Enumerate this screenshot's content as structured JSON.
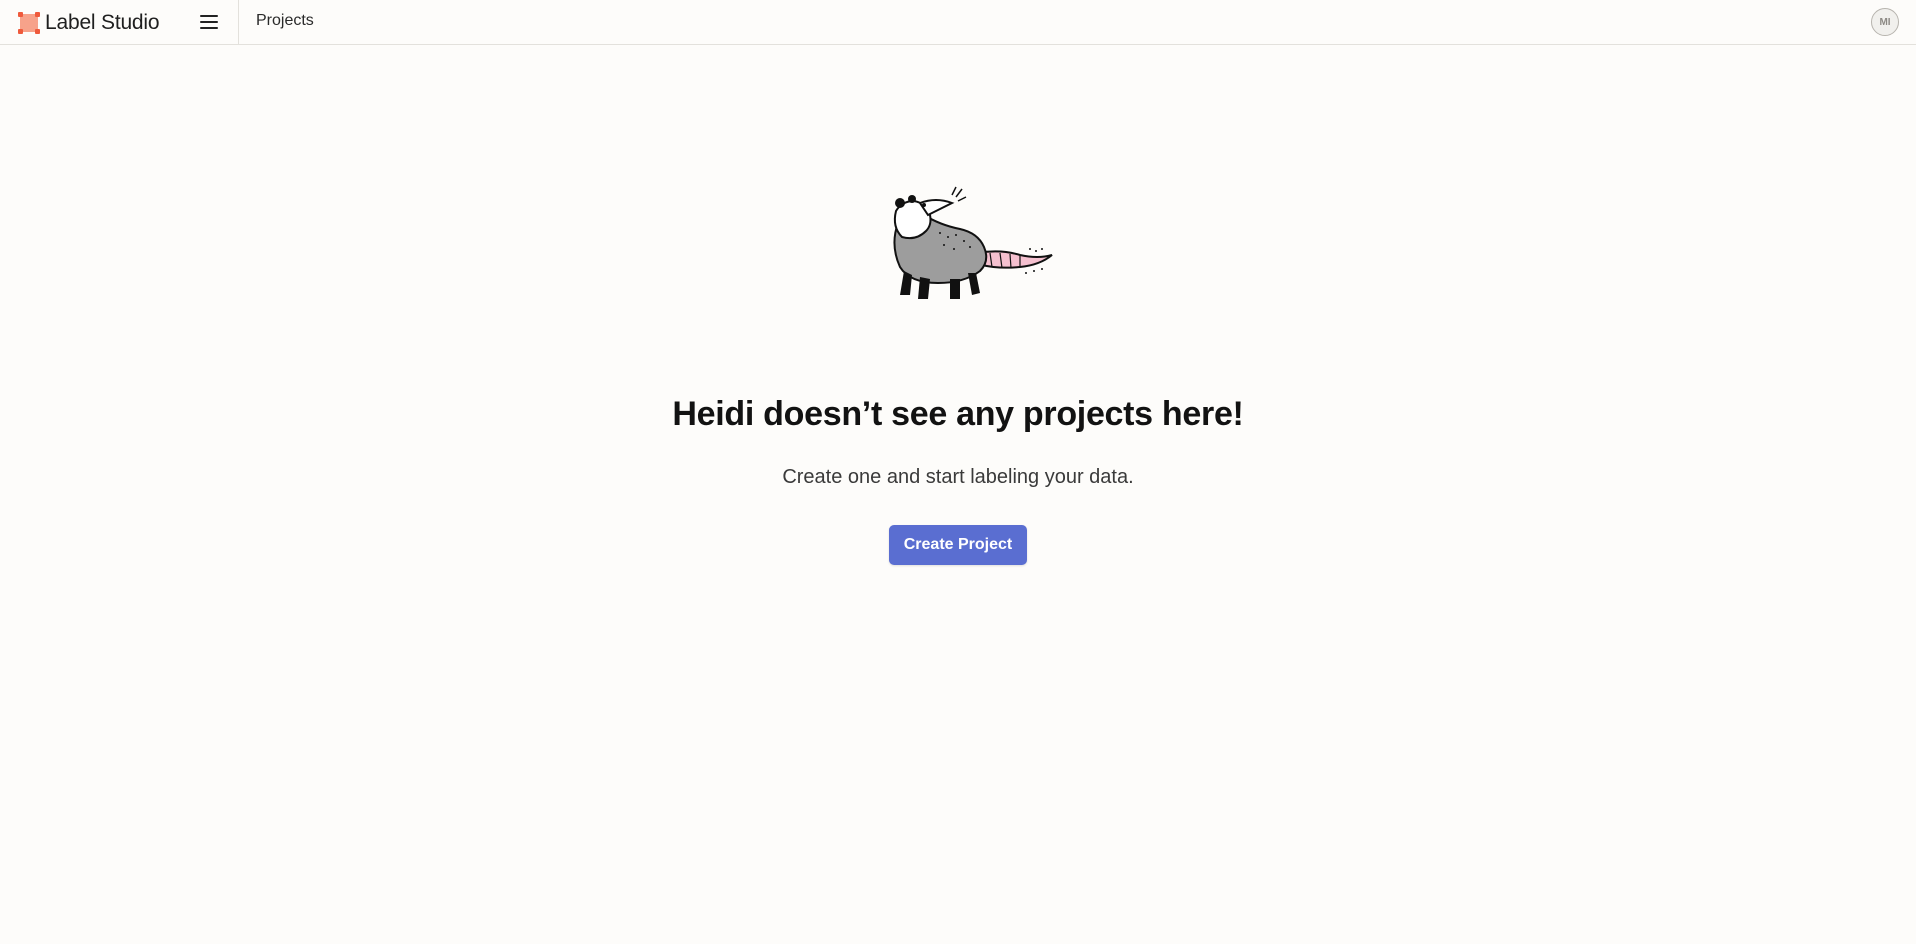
{
  "app": {
    "name": "Label Studio",
    "brand_color": "#f07050"
  },
  "header": {
    "menu_icon": "hamburger-icon",
    "breadcrumb": "Projects",
    "user_initials": "MI"
  },
  "empty_state": {
    "illustration": "opossum-illustration",
    "title": "Heidi doesn’t see any projects here!",
    "subtitle": "Create one and start labeling your data.",
    "button_label": "Create Project",
    "button_color": "#5a6ed1"
  }
}
